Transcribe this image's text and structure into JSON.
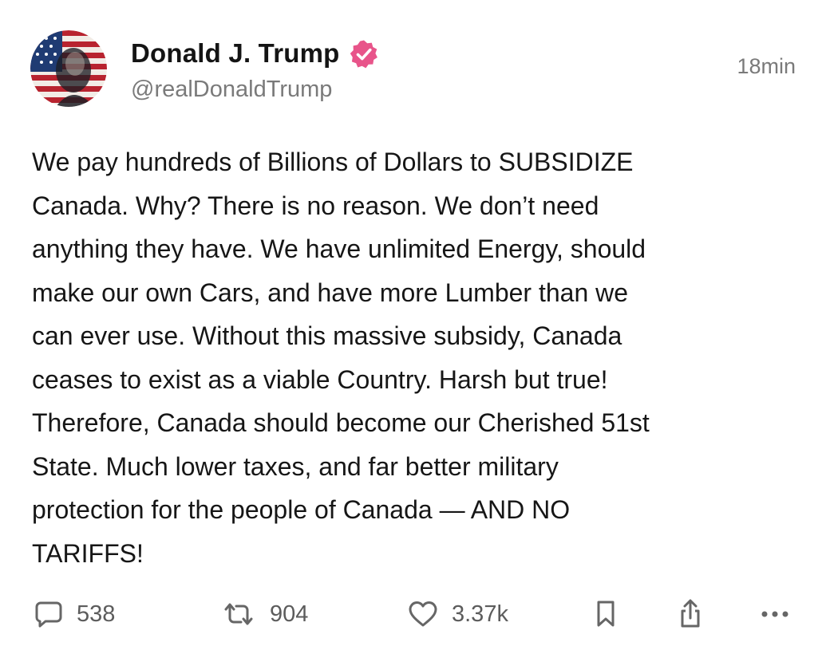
{
  "post": {
    "author": {
      "display_name": "Donald J. Trump",
      "handle": "@realDonaldTrump",
      "verified": true,
      "avatar_icon": "profile-avatar"
    },
    "timestamp": "18min",
    "body": "We pay hundreds of Billions of Dollars to SUBSIDIZE Canada. Why? There is no reason. We don’t need anything they have. We have unlimited Energy, should make our own Cars, and have more Lumber than we can ever use. Without this massive subsidy, Canada ceases to exist as a viable Country. Harsh but true! Therefore, Canada should become our Cherished 51st State. Much lower taxes, and far better military protection for the people of Canada — AND NO TARIFFS!",
    "body_lines": [
      "We pay hundreds of Billions of Dollars to SUBSIDIZE",
      "Canada. Why? There is no reason. We don’t need",
      "anything they have. We have unlimited Energy, should",
      "make our own Cars, and have more Lumber than we",
      "can ever use. Without this massive subsidy, Canada",
      "ceases to exist as a viable Country. Harsh but true!",
      "Therefore, Canada should become our Cherished 51st",
      "State. Much lower taxes, and far better military",
      "protection for the people of Canada — AND NO",
      "TARIFFS!"
    ],
    "actions": {
      "replies": {
        "icon": "reply-bubble-icon",
        "count": "538"
      },
      "retruths": {
        "icon": "repost-icon",
        "count": "904"
      },
      "likes": {
        "icon": "heart-icon",
        "count": "3.37k"
      },
      "bookmark": {
        "icon": "bookmark-icon"
      },
      "share": {
        "icon": "share-icon"
      },
      "more": {
        "icon": "more-dots-icon"
      }
    }
  },
  "colors": {
    "verified_badge": "#e8548a",
    "text_primary": "#161616",
    "text_secondary": "#7a7a7a",
    "icon_gray": "#666666"
  }
}
